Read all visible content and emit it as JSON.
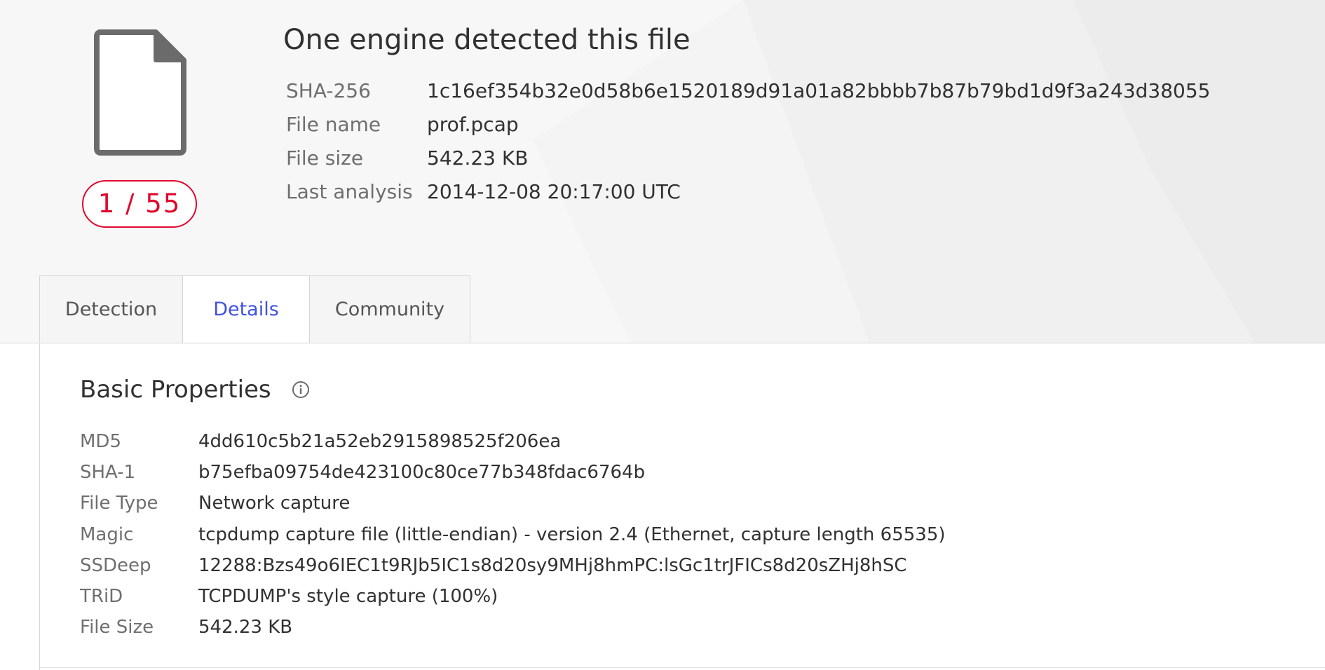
{
  "summary": {
    "title": "One engine detected this file",
    "detection_ratio": "1 / 55",
    "rows": [
      {
        "label": "SHA-256",
        "value": "1c16ef354b32e0d58b6e1520189d91a01a82bbbb7b87b79bd1d9f3a243d38055"
      },
      {
        "label": "File name",
        "value": "prof.pcap"
      },
      {
        "label": "File size",
        "value": "542.23 KB"
      },
      {
        "label": "Last analysis",
        "value": "2014-12-08 20:17:00 UTC"
      }
    ]
  },
  "tabs": [
    {
      "label": "Detection",
      "active": false
    },
    {
      "label": "Details",
      "active": true
    },
    {
      "label": "Community",
      "active": false
    }
  ],
  "basic_properties": {
    "title": "Basic Properties",
    "rows": [
      {
        "label": "MD5",
        "value": "4dd610c5b21a52eb2915898525f206ea"
      },
      {
        "label": "SHA-1",
        "value": "b75efba09754de423100c80ce77b348fdac6764b"
      },
      {
        "label": "File Type",
        "value": "Network capture"
      },
      {
        "label": "Magic",
        "value": "tcpdump capture file (little-endian) - version 2.4 (Ethernet, capture length 65535)"
      },
      {
        "label": "SSDeep",
        "value": "12288:Bzs49o6IEC1t9RJb5IC1s8d20sy9MHj8hmPC:lsGc1trJFICs8d20sZHj8hSC"
      },
      {
        "label": "TRiD",
        "value": "TCPDUMP's style capture (100%)"
      },
      {
        "label": "File Size",
        "value": "542.23 KB"
      }
    ]
  },
  "icons": {
    "file": "file-icon",
    "info": "info-icon"
  },
  "colors": {
    "accent": "#3f51e6",
    "detection": "#e0082e"
  }
}
